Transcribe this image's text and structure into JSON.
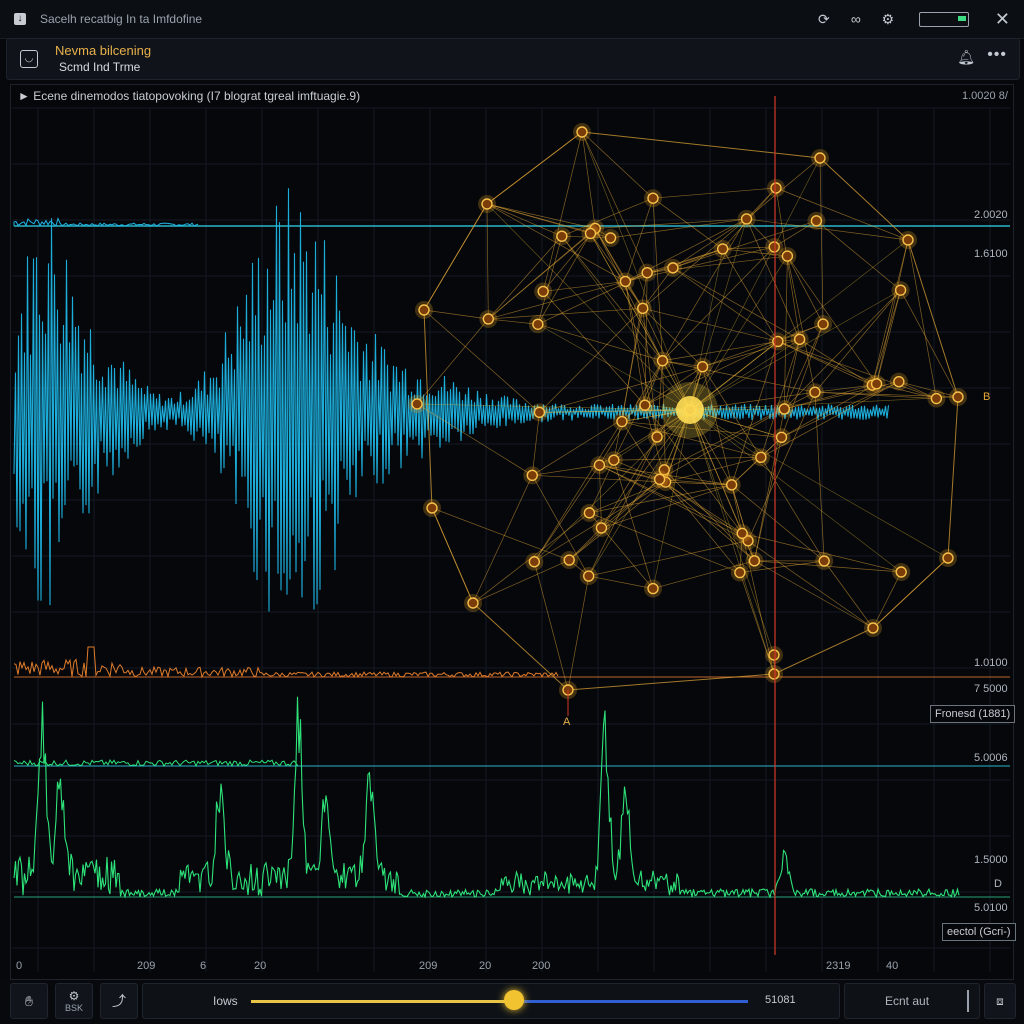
{
  "window": {
    "title": "Sacelh recatbig In ta Imfdofine",
    "icons": [
      "download-icon",
      "sync-icon",
      "link-icon",
      "battery-icon",
      "close-icon"
    ]
  },
  "header": {
    "title": "Nevma bilcening",
    "subtitle": "Scmd Ind Trme"
  },
  "panel": {
    "label": "Ecene dinemodos tiatopovoking (I7 blograt tgreal imftuagie.9)",
    "top_right_value": "1.0020 8/"
  },
  "scales": {
    "s1": "2.0020",
    "s2": "1.6100",
    "s3": "1.0100",
    "s4": "7 5000",
    "s5": "5.0006",
    "s6": "1.5000",
    "s7": "5.0100",
    "d": "D",
    "b": "B"
  },
  "boxes": {
    "forecast": "Fronesd (1881)",
    "control": "eectol (Gcri-)"
  },
  "markers": {
    "a": "A"
  },
  "xaxis": [
    "0",
    "209",
    "6",
    "20",
    "209",
    "20",
    "200",
    "2319",
    "40"
  ],
  "bottombar": {
    "btn2_label": "BSK",
    "slider_label": "Iows",
    "slider_value": "51081",
    "slider_fraction": 0.53,
    "right_label": "Ecnt aut"
  },
  "colors": {
    "waveform": "#1fb6e6",
    "network": "#e8a936",
    "spectrum_orange": "#e07b2a",
    "spectrum_green": "#2ee37a",
    "cursor": "#d43a2a"
  }
}
